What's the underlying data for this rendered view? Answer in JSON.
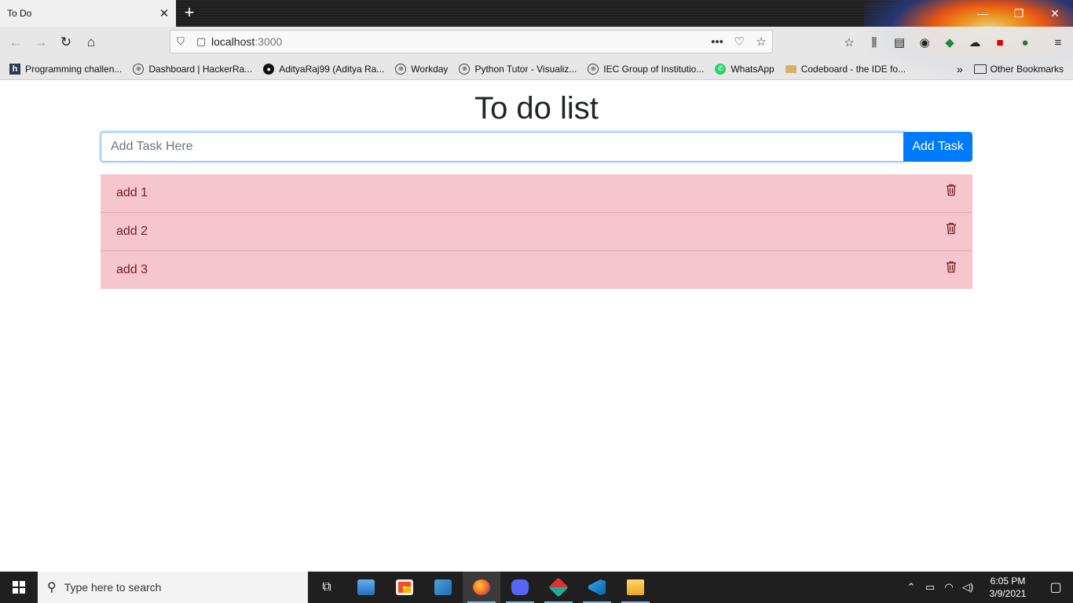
{
  "browser": {
    "tab_title": "To Do",
    "url_host": "localhost",
    "url_port": ":3000",
    "bookmarks": [
      {
        "label": "Programming challen...",
        "icon": "hackerrank-icon"
      },
      {
        "label": "Dashboard | HackerRa...",
        "icon": "globe-icon"
      },
      {
        "label": "AdityaRaj99 (Aditya Ra...",
        "icon": "github-icon"
      },
      {
        "label": "Workday",
        "icon": "globe-icon"
      },
      {
        "label": "Python Tutor - Visualiz...",
        "icon": "globe-icon"
      },
      {
        "label": "IEC Group of Institutio...",
        "icon": "globe-icon"
      },
      {
        "label": "WhatsApp",
        "icon": "whatsapp-icon"
      },
      {
        "label": "Codeboard - the IDE fo...",
        "icon": "codeboard-icon"
      }
    ],
    "other_bookmarks": "Other Bookmarks"
  },
  "app": {
    "title": "To do list",
    "input_placeholder": "Add Task Here",
    "input_value": "",
    "add_button": "Add Task",
    "tasks": [
      {
        "text": "add 1"
      },
      {
        "text": "add 2"
      },
      {
        "text": "add 3"
      }
    ],
    "colors": {
      "primary": "#007bff",
      "task_bg": "#f5c6cb",
      "task_text": "#721c24"
    }
  },
  "taskbar": {
    "search_placeholder": "Type here to search",
    "time": "6:05 PM",
    "date": "3/9/2021"
  }
}
